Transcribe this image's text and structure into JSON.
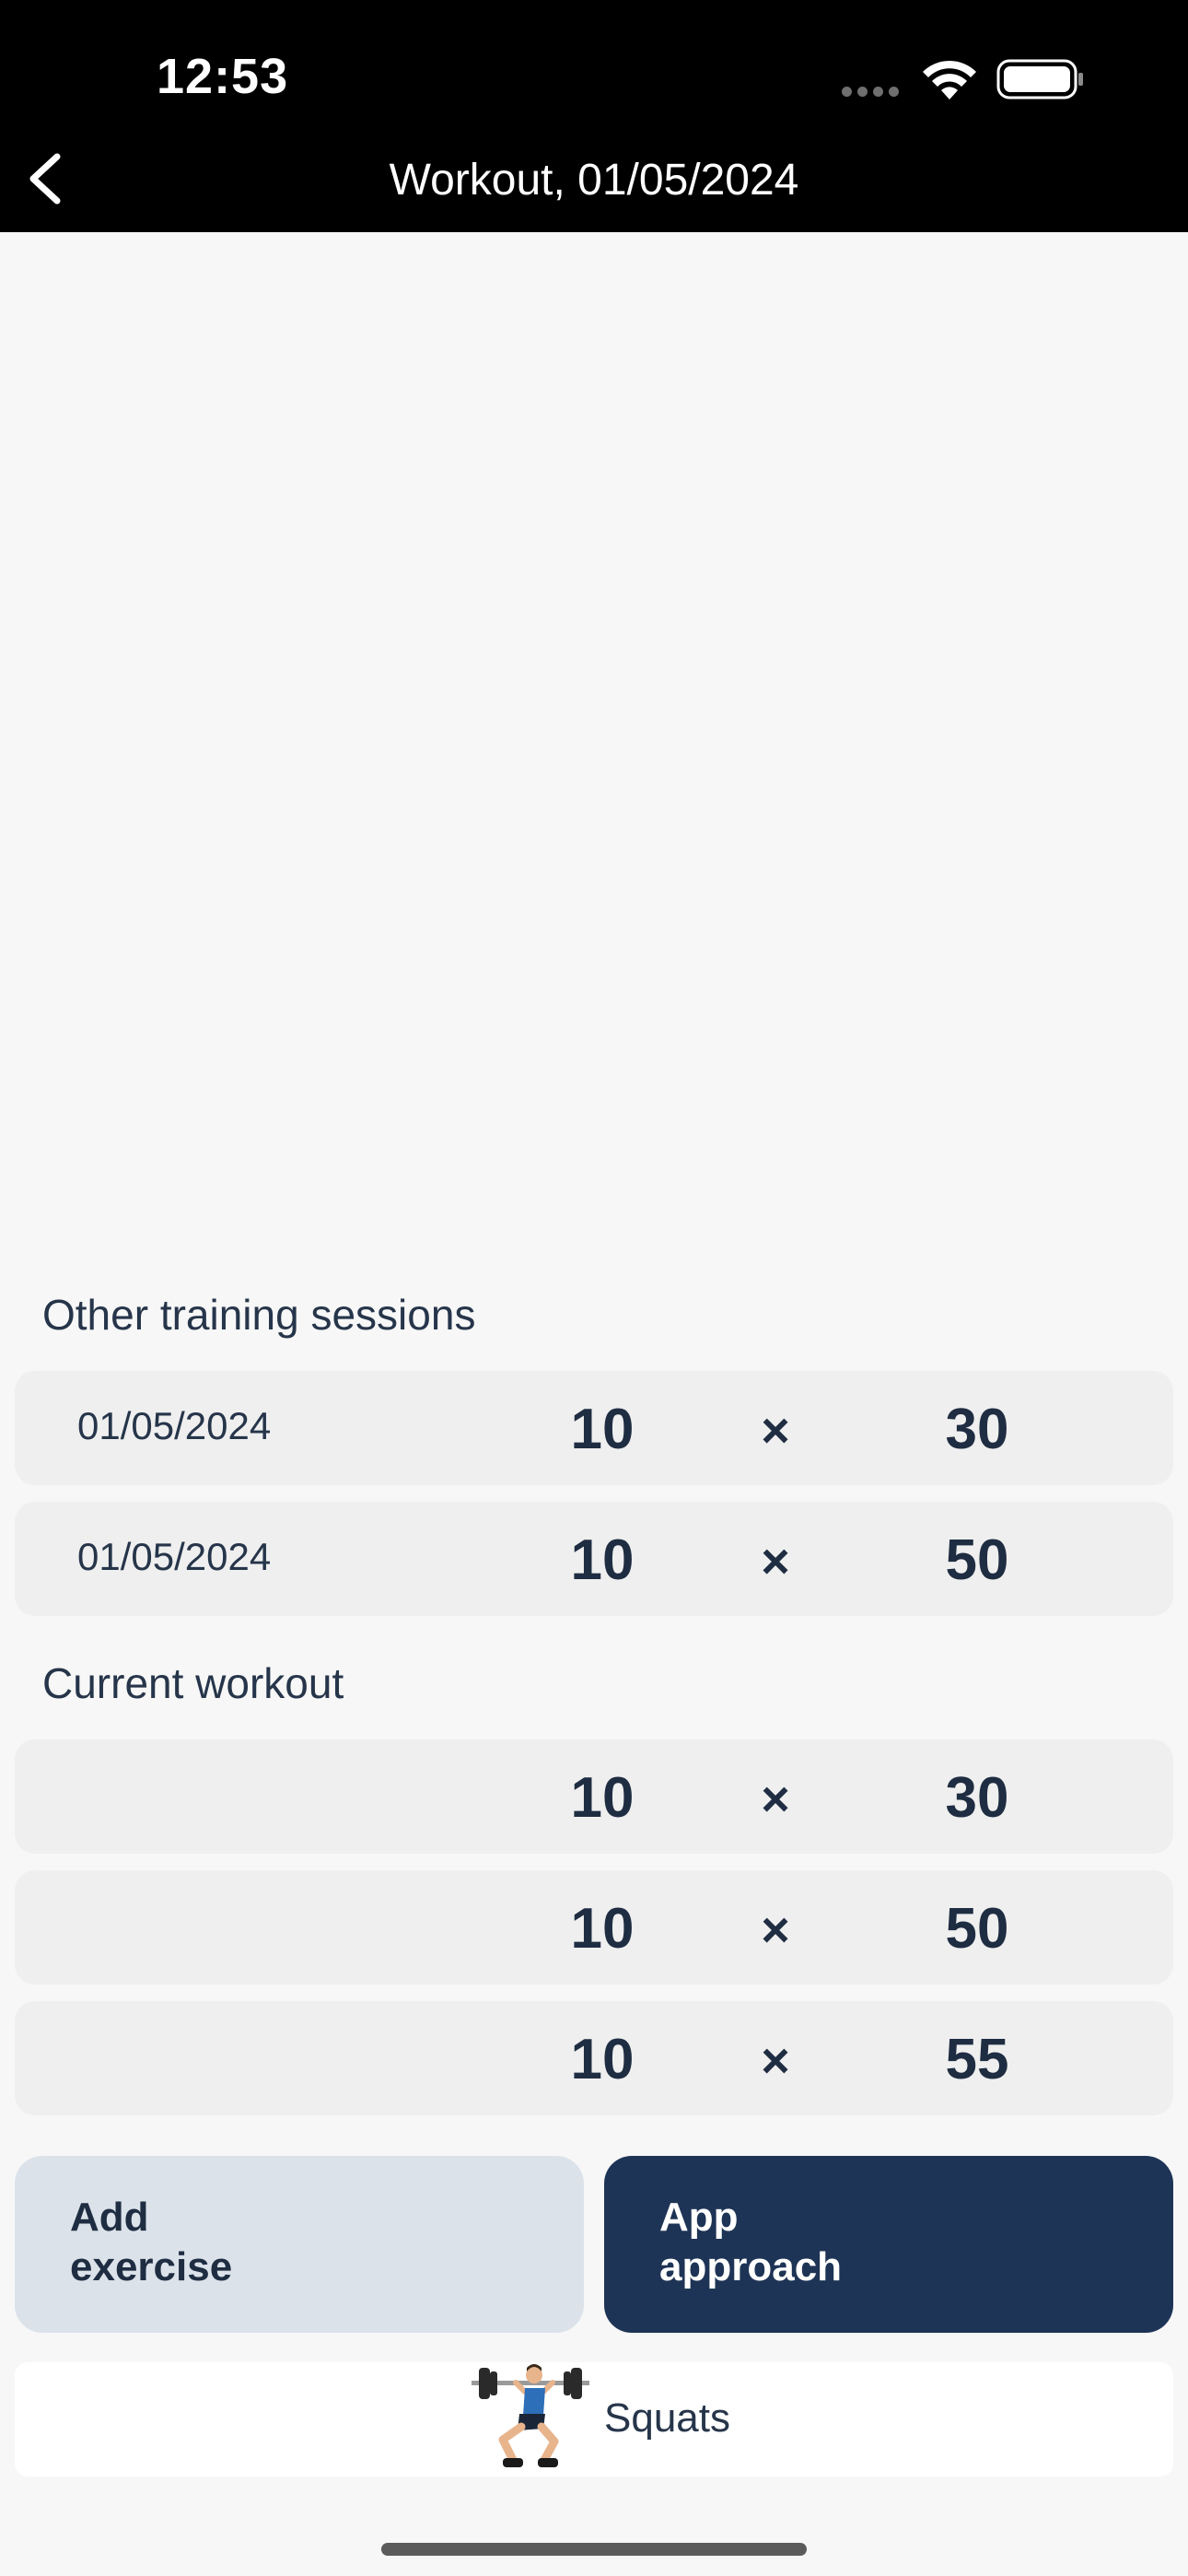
{
  "status_bar": {
    "time": "12:53"
  },
  "nav": {
    "title": "Workout, 01/05/2024"
  },
  "other_sessions": {
    "heading": "Other training sessions",
    "rows": [
      {
        "date": "01/05/2024",
        "reps": "10",
        "sep": "×",
        "weight": "30"
      },
      {
        "date": "01/05/2024",
        "reps": "10",
        "sep": "×",
        "weight": "50"
      }
    ]
  },
  "current_workout": {
    "heading": "Current workout",
    "rows": [
      {
        "reps": "10",
        "sep": "×",
        "weight": "30"
      },
      {
        "reps": "10",
        "sep": "×",
        "weight": "50"
      },
      {
        "reps": "10",
        "sep": "×",
        "weight": "55"
      }
    ]
  },
  "buttons": {
    "add_exercise_line1": "Add",
    "add_exercise_line2": "exercise",
    "app_approach_line1": "App",
    "app_approach_line2": "approach"
  },
  "exercise": {
    "name": "Squats",
    "icon": "squat-barbell-icon"
  },
  "colors": {
    "header_bg": "#000000",
    "row_bg": "#efefef",
    "primary_dark": "#1e3456",
    "secondary_light": "#dbe2ea",
    "text": "#1f2d42"
  }
}
